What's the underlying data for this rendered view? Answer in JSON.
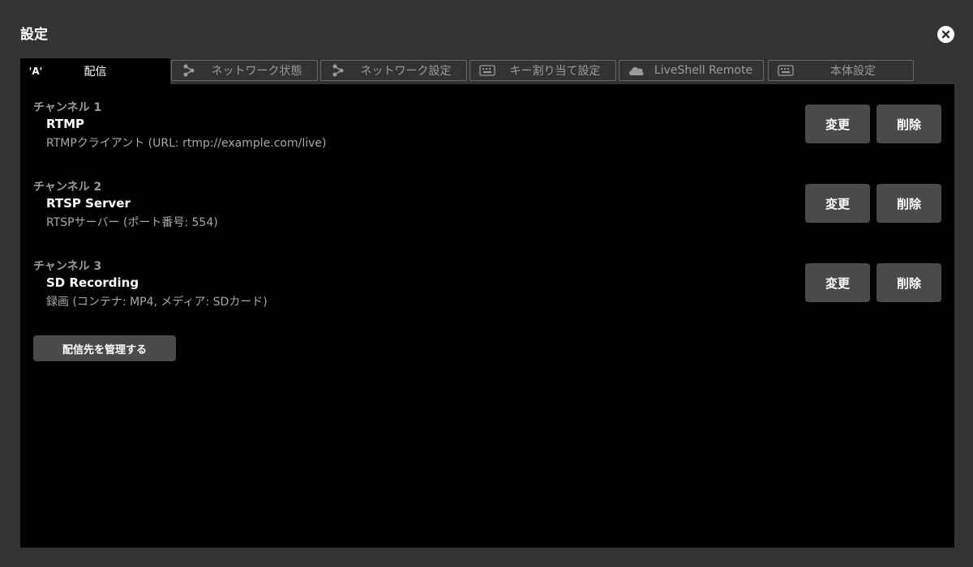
{
  "window": {
    "title": "設定"
  },
  "icons": {
    "close": "close-icon",
    "tab_icons": [
      "broadcast-icon",
      "share-icon",
      "share-icon",
      "keyboard-icon",
      "cloud-icon",
      "keyboard-icon"
    ]
  },
  "tabs": [
    {
      "label": "配信",
      "icon_text": "'A'",
      "active": true
    },
    {
      "label": "ネットワーク状態",
      "active": false
    },
    {
      "label": "ネットワーク設定",
      "active": false
    },
    {
      "label": "キー割り当て設定",
      "active": false
    },
    {
      "label": "LiveShell Remote",
      "active": false
    },
    {
      "label": "本体設定",
      "active": false
    }
  ],
  "channels": [
    {
      "title": "チャンネル 1",
      "name": "RTMP",
      "description": "RTMPクライアント (URL: rtmp://example.com/live)",
      "change_label": "変更",
      "delete_label": "削除"
    },
    {
      "title": "チャンネル 2",
      "name": "RTSP Server",
      "description": "RTSPサーバー (ポート番号: 554)",
      "change_label": "変更",
      "delete_label": "削除"
    },
    {
      "title": "チャンネル 3",
      "name": "SD Recording",
      "description": "録画 (コンテナ: MP4, メディア: SDカード)",
      "change_label": "変更",
      "delete_label": "削除"
    }
  ],
  "manage_button": {
    "label": "配信先を管理する"
  },
  "colors": {
    "background": "#333333",
    "panel": "#000000",
    "button": "#4a4a4a",
    "muted_text": "#9a9a9a"
  }
}
